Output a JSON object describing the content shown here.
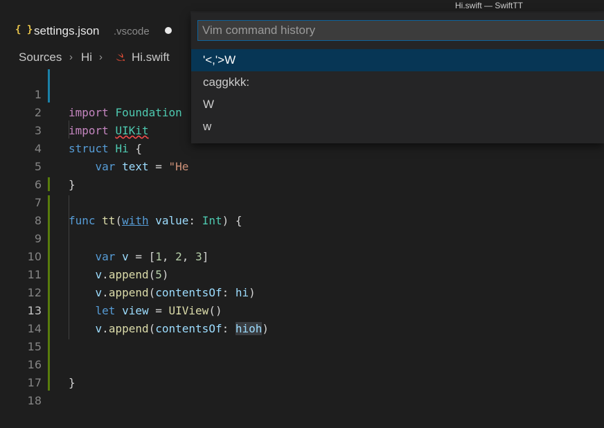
{
  "window": {
    "title": "Hi.swift — SwiftTT"
  },
  "tab": {
    "icon": "{ }",
    "label": "settings.json",
    "description": ".vscode"
  },
  "breadcrumb": {
    "items": [
      "Sources",
      "Hi",
      "Hi.swift"
    ],
    "file_icon": "swift-icon"
  },
  "editor": {
    "active_line": 13,
    "lines": [
      {
        "n": "1",
        "text": "import Foundation"
      },
      {
        "n": "2",
        "text": "import UIKit"
      },
      {
        "n": "3",
        "text": "struct Hi {"
      },
      {
        "n": "4",
        "text": "    var text = \"He"
      },
      {
        "n": "5",
        "text": "}"
      },
      {
        "n": "6",
        "text": ""
      },
      {
        "n": "7",
        "text": "func tt(with value: Int) {"
      },
      {
        "n": "8",
        "text": ""
      },
      {
        "n": "9",
        "text": "    var v = [1, 2, 3]"
      },
      {
        "n": "10",
        "text": "    v.append(5)"
      },
      {
        "n": "11",
        "text": "    v.append(contentsOf: hi)"
      },
      {
        "n": "12",
        "text": "    let view = UIView()"
      },
      {
        "n": "13",
        "text": "    v.append(contentsOf: hioh)"
      },
      {
        "n": "14",
        "text": ""
      },
      {
        "n": "15",
        "text": ""
      },
      {
        "n": "16",
        "text": "}"
      },
      {
        "n": "17",
        "text": ""
      },
      {
        "n": "18",
        "text": ""
      }
    ]
  },
  "palette": {
    "placeholder": "Vim command history",
    "value": "",
    "items": [
      "'<,'>W",
      "caggkkk:",
      "W",
      "w"
    ],
    "selected_index": 0
  },
  "colors": {
    "accent": "#0e639c",
    "selection": "#073655",
    "modified_gutter": "#1b81a8",
    "added_gutter": "#587c0c",
    "keyword": "#c586c0",
    "type": "#4ec9b0",
    "string": "#ce9178"
  }
}
